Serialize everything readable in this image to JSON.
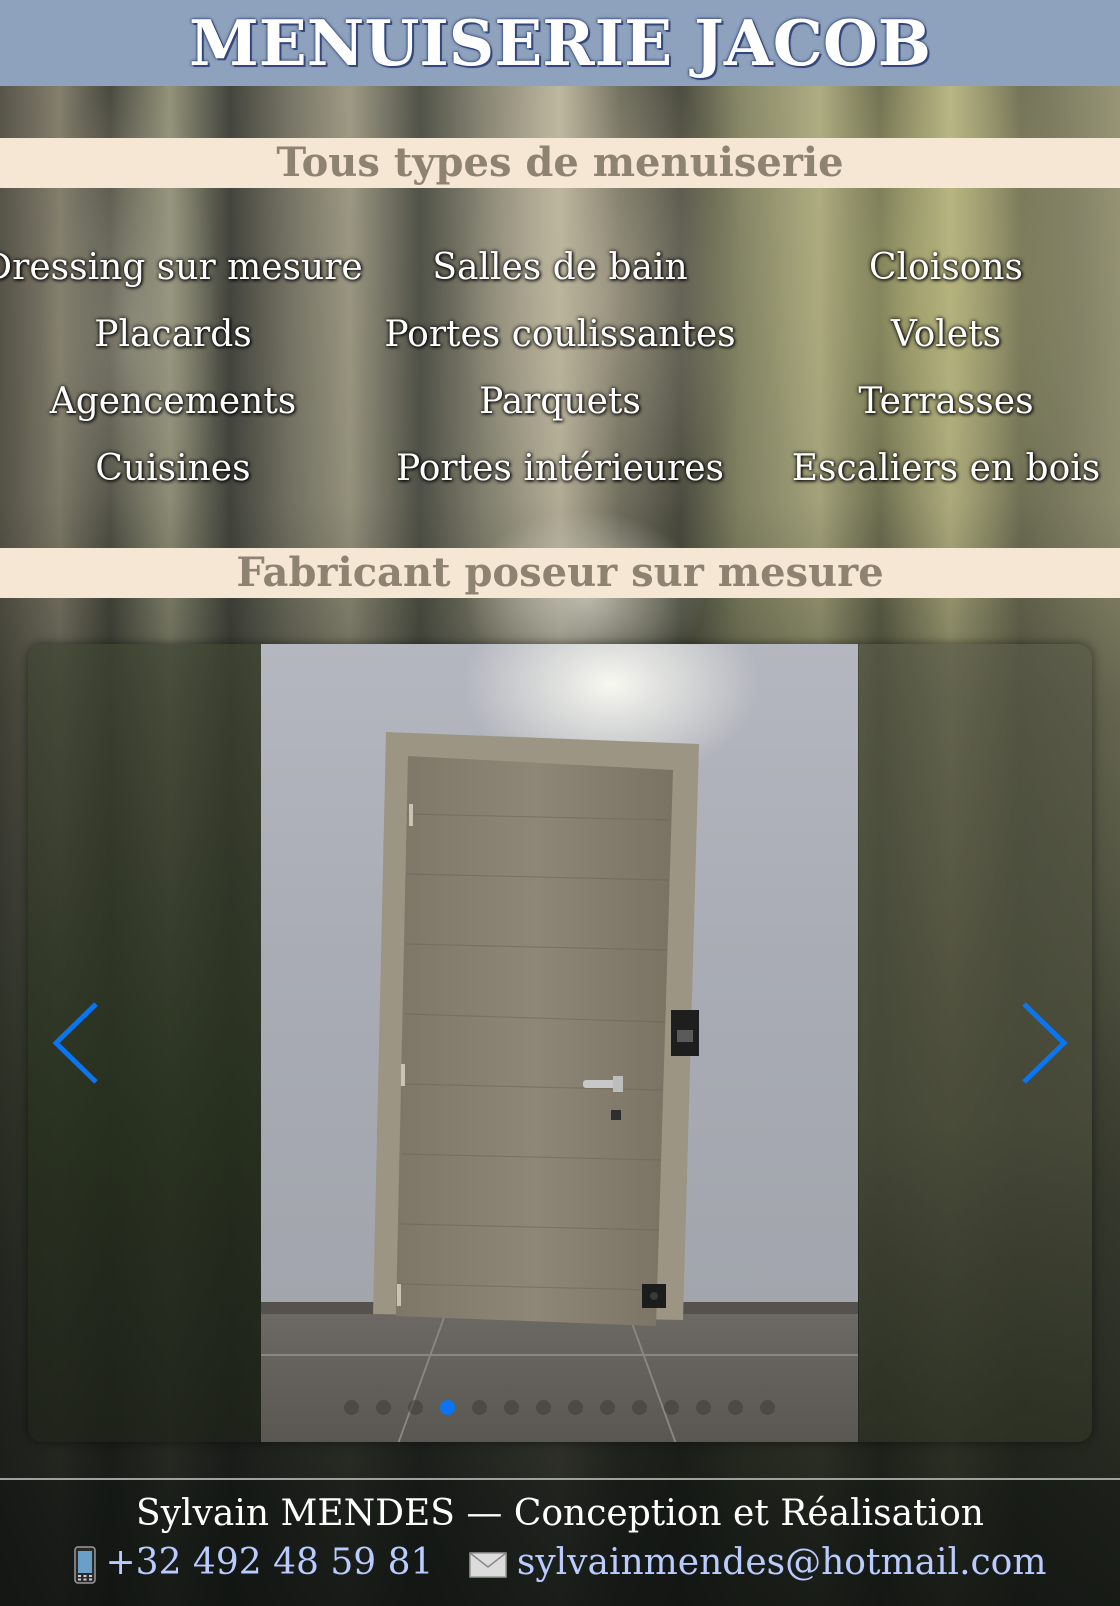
{
  "header": {
    "title": "MENUISERIE JACOB",
    "bg_color": "#8ea2bd"
  },
  "section1": {
    "title": "Tous types de menuiserie"
  },
  "services": {
    "columns": [
      [
        "Dressing sur mesure",
        "Placards",
        "Agencements",
        "Cuisines"
      ],
      [
        "Salles de bain",
        "Portes coulissantes",
        "Parquets",
        "Portes intérieures"
      ],
      [
        "Cloisons",
        "Volets",
        "Terrasses",
        "Escaliers en bois"
      ]
    ]
  },
  "section2": {
    "title": "Fabricant poseur sur mesure"
  },
  "slider": {
    "prev_icon": "chevron-left-icon",
    "next_icon": "chevron-right-icon",
    "dot_count": 14,
    "active_index": 3,
    "accent_color": "#0a75f0"
  },
  "footer": {
    "credit": "Sylvain MENDES — Conception et Réalisation",
    "phone_icon": "mobile-phone-icon",
    "phone": "+32 492 48 59 81",
    "email_icon": "envelope-icon",
    "email": "sylvainmendes@hotmail.com",
    "link_color": "#b9cbff"
  }
}
